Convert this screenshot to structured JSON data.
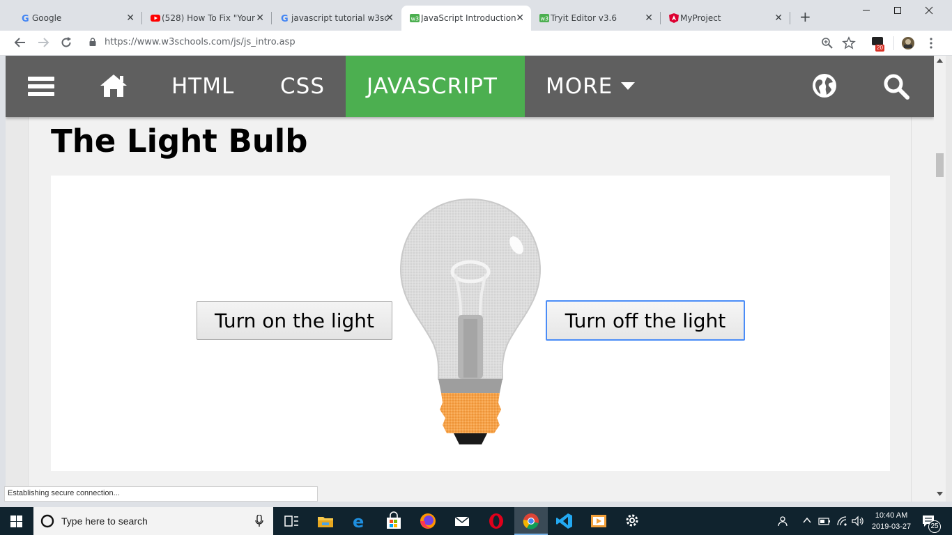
{
  "browser": {
    "tabs": [
      {
        "title": "Google",
        "icon": "google-icon",
        "active": false
      },
      {
        "title": "(528) How To Fix \"Your",
        "icon": "youtube-icon",
        "active": false
      },
      {
        "title": "javascript tutorial w3sc",
        "icon": "google-icon",
        "active": false
      },
      {
        "title": "JavaScript Introduction",
        "icon": "w3schools-icon",
        "active": true
      },
      {
        "title": "Tryit Editor v3.6",
        "icon": "w3schools-icon",
        "active": false
      },
      {
        "title": "MyProject",
        "icon": "angular-icon",
        "active": false
      }
    ],
    "close_glyph": "✕",
    "new_tab_glyph": "+",
    "url_host": "https://www.w3schools.com",
    "url_path": "/js/js_intro.asp",
    "extension_badge": "20",
    "status_text": "Establishing secure connection..."
  },
  "w3nav": {
    "html": "HTML",
    "css": "CSS",
    "javascript": "JAVASCRIPT",
    "more": "MORE",
    "more_caret": "▾"
  },
  "content": {
    "title": "The Light Bulb",
    "turn_on": "Turn on the light",
    "turn_off": "Turn off the light"
  },
  "taskbar": {
    "search_placeholder": "Type here to search",
    "time": "10:40 AM",
    "date": "2019-03-27",
    "notification_count": "25"
  },
  "colors": {
    "nav_bg": "#5f5f5f",
    "nav_active": "#4caf50",
    "focus_border": "#4a8cf7",
    "taskbar": "#10232e"
  }
}
